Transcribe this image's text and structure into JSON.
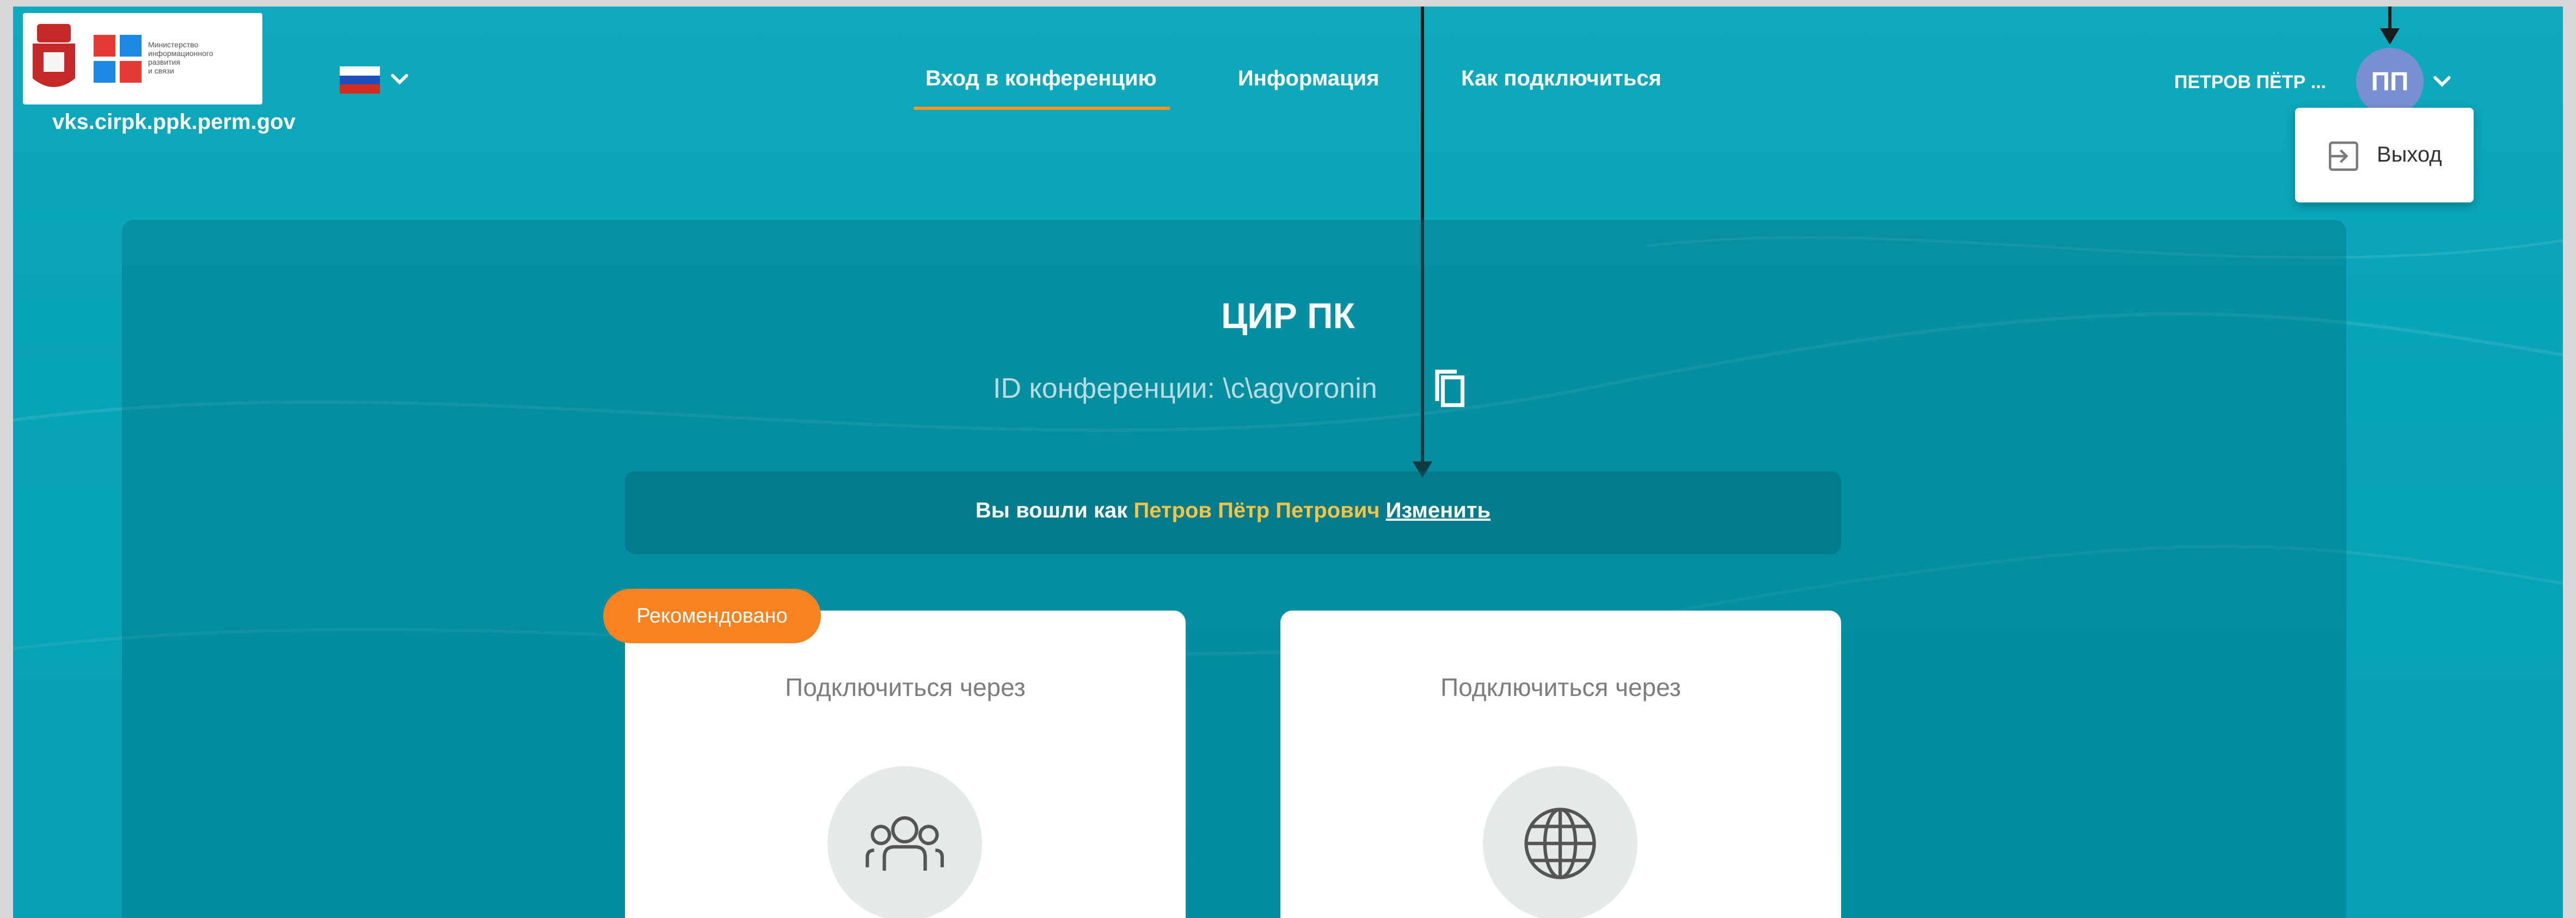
{
  "header": {
    "logo_text": [
      "Министерство",
      "информационного",
      "развития",
      "и связи"
    ],
    "domain": "vks.cirpk.ppk.perm.gov",
    "language_flag": "flag-ru-icon",
    "nav": [
      {
        "label": "Вход в конференцию",
        "active": true
      },
      {
        "label": "Информация",
        "active": false
      },
      {
        "label": "Как подключиться",
        "active": false
      }
    ],
    "accent_color": "#f7941d",
    "user": {
      "name": "ПЕТРОВ ПЁТР ...",
      "initials": "ПП"
    },
    "user_menu": [
      {
        "label": "Выход",
        "icon": "logout-icon"
      }
    ]
  },
  "conference": {
    "title": "ЦИР ПК",
    "id_label": "ID конференции: \\c\\agvoronin",
    "login": {
      "prefix": "Вы вошли как",
      "name": "Петров Пётр Петрович",
      "change": "Изменить"
    },
    "options": [
      {
        "label": "Подключиться через",
        "icon": "group-icon",
        "badge": "Рекомендовано"
      },
      {
        "label": "Подключиться через",
        "icon": "globe-icon"
      }
    ]
  }
}
